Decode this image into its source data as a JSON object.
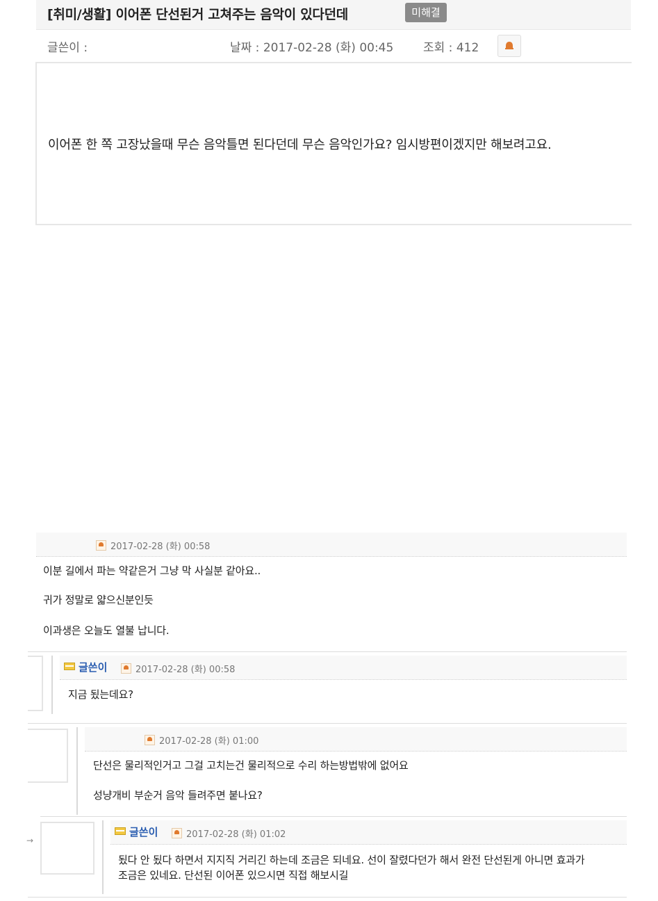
{
  "post": {
    "title": "[취미/생활] 이어폰 단선된거 고쳐주는 음악이 있다던데",
    "status_badge": "미해결",
    "author_label": "글쓴이 :",
    "date_label": "날짜 : 2017-02-28 (화) 00:45",
    "views_label": "조회 : 412",
    "body": "이어폰 한 쪽 고장났을때 무슨 음악틀면 된다던데 무슨 음악인가요? 임시방편이겠지만 해보려고요."
  },
  "comments": [
    {
      "date": "2017-02-28 (화) 00:58",
      "lines": [
        "이분 길에서 파는 약같은거 그냥 막 사실분 같아요..",
        "귀가 정말로 얇으신분인듯",
        "이과생은 오늘도 열불 납니다."
      ]
    },
    {
      "author": "글쓴이",
      "date": "2017-02-28 (화) 00:58",
      "lines": [
        "지금 됬는데요?"
      ]
    },
    {
      "date": "2017-02-28 (화) 01:00",
      "lines": [
        "단선은 물리적인거고 그걸 고치는건 물리적으로 수리 하는방법밖에 없어요",
        "성냥개비 부순거 음악 들려주면 붙나요?"
      ]
    },
    {
      "author": "글쓴이",
      "date": "2017-02-28 (화) 01:02",
      "lines": [
        "됬다 안 됬다 하면서 지지직 거리긴 하는데 조금은 되네요. 선이 잘렸다던가 해서 완전 단선된게 아니면 효과가",
        "조금은 있네요. 단선된 이어폰 있으시면 직접 해보시길"
      ]
    }
  ],
  "icons": {
    "report": "bell-icon",
    "comment_report": "bell-icon",
    "author_badge": "author-badge-icon"
  },
  "colors": {
    "accent_orange": "#e07a2e",
    "author_blue": "#2a5db0",
    "badge_gray": "#8a8a8a"
  }
}
